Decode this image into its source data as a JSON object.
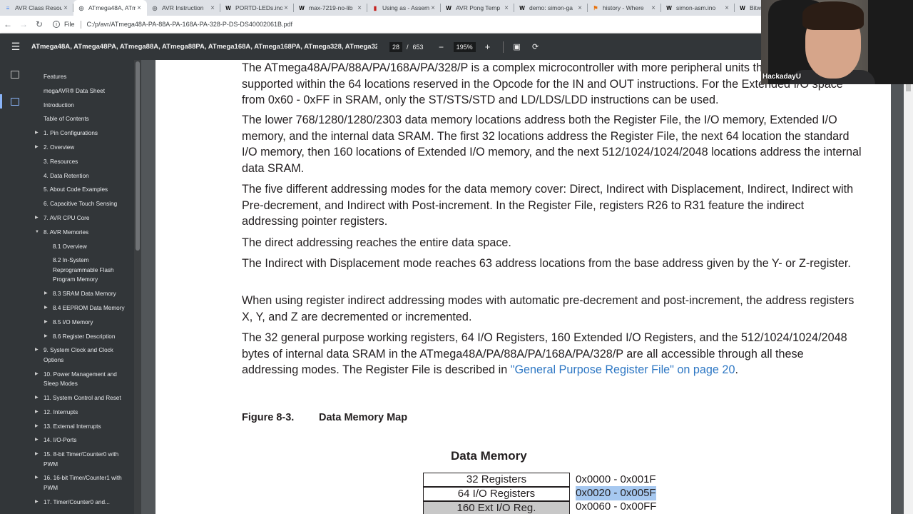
{
  "tabs": [
    {
      "label": "AVR Class Resou",
      "icon": "docs-icon",
      "color": "#4285f4",
      "active": false
    },
    {
      "label": "ATmega48A, ATm",
      "icon": "chrome-icon",
      "color": "#5f6368",
      "active": true
    },
    {
      "label": "AVR Instruction",
      "icon": "chrome-icon",
      "color": "#5f6368",
      "active": false
    },
    {
      "label": "PORTD-LEDs.ino",
      "icon": "wikipedia-icon",
      "color": "#000000",
      "active": false
    },
    {
      "label": "max-7219-no-lib",
      "icon": "wikipedia-icon",
      "color": "#000000",
      "active": false
    },
    {
      "label": "Using as - Assem",
      "icon": "uspto-icon",
      "color": "#c5221f",
      "active": false
    },
    {
      "label": "AVR Pong Temp",
      "icon": "wikipedia-icon",
      "color": "#000000",
      "active": false
    },
    {
      "label": "demo: simon-ga",
      "icon": "wikipedia-icon",
      "color": "#000000",
      "active": false
    },
    {
      "label": "history - Where",
      "icon": "bookmark-icon",
      "color": "#e8710a",
      "active": false
    },
    {
      "label": "simon-asm.ino",
      "icon": "wikipedia-icon",
      "color": "#000000",
      "active": false
    },
    {
      "label": "Bitw",
      "icon": "wikipedia-icon",
      "color": "#000000",
      "active": false
    }
  ],
  "address": {
    "scheme_label": "File",
    "url": "C:/p/avr/ATmega48A-PA-88A-PA-168A-PA-328-P-DS-DS40002061B.pdf"
  },
  "pdf_toolbar": {
    "title": "ATmega48A, ATmega48PA, ATmega88A, ATmega88PA, ATmega168A, ATmega168PA, ATmega328, ATmega328...",
    "page_current": "28",
    "page_sep": "/",
    "page_total": "653",
    "zoom": "195%"
  },
  "outline": [
    {
      "label": "Features",
      "indent": 0,
      "arrow": "",
      "lines": 1
    },
    {
      "label": "megaAVR® Data Sheet",
      "indent": 0,
      "arrow": "",
      "lines": 1
    },
    {
      "label": "Introduction",
      "indent": 0,
      "arrow": "",
      "lines": 1
    },
    {
      "label": "Table of Contents",
      "indent": 0,
      "arrow": "",
      "lines": 1
    },
    {
      "label": "1. Pin Configurations",
      "indent": 0,
      "arrow": "▶",
      "lines": 1
    },
    {
      "label": "2. Overview",
      "indent": 0,
      "arrow": "▶",
      "lines": 1
    },
    {
      "label": "3. Resources",
      "indent": 0,
      "arrow": "",
      "lines": 1
    },
    {
      "label": "4. Data Retention",
      "indent": 0,
      "arrow": "",
      "lines": 1
    },
    {
      "label": "5. About Code Examples",
      "indent": 0,
      "arrow": "",
      "lines": 1
    },
    {
      "label": "6. Capacitive Touch Sensing",
      "indent": 0,
      "arrow": "",
      "lines": 1
    },
    {
      "label": "7. AVR CPU Core",
      "indent": 0,
      "arrow": "▶",
      "lines": 1
    },
    {
      "label": "8. AVR Memories",
      "indent": 0,
      "arrow": "▼",
      "lines": 1
    },
    {
      "label": "8.1 Overview",
      "indent": 1,
      "arrow": "",
      "lines": 1
    },
    {
      "label": "8.2 In-System Reprogrammable Flash Program Memory",
      "indent": 1,
      "arrow": "",
      "lines": 3
    },
    {
      "label": "8.3 SRAM Data Memory",
      "indent": 1,
      "arrow": "▶",
      "lines": 1
    },
    {
      "label": "8.4 EEPROM Data Memory",
      "indent": 1,
      "arrow": "▶",
      "lines": 2
    },
    {
      "label": "8.5 I/O Memory",
      "indent": 1,
      "arrow": "▶",
      "lines": 1
    },
    {
      "label": "8.6 Register Description",
      "indent": 1,
      "arrow": "▶",
      "lines": 1
    },
    {
      "label": "9. System Clock and Clock Options",
      "indent": 0,
      "arrow": "▶",
      "lines": 2
    },
    {
      "label": "10. Power Management and Sleep Modes",
      "indent": 0,
      "arrow": "▶",
      "lines": 2
    },
    {
      "label": "11. System Control and Reset",
      "indent": 0,
      "arrow": "▶",
      "lines": 1
    },
    {
      "label": "12. Interrupts",
      "indent": 0,
      "arrow": "▶",
      "lines": 1
    },
    {
      "label": "13. External Interrupts",
      "indent": 0,
      "arrow": "▶",
      "lines": 1
    },
    {
      "label": "14. I/O-Ports",
      "indent": 0,
      "arrow": "▶",
      "lines": 1
    },
    {
      "label": "15. 8-bit Timer/Counter0 with PWM",
      "indent": 0,
      "arrow": "▶",
      "lines": 2
    },
    {
      "label": "16. 16-bit Timer/Counter1 with PWM",
      "indent": 0,
      "arrow": "▶",
      "lines": 2
    },
    {
      "label": "17. Timer/Counter0 and...",
      "indent": 0,
      "arrow": "▶",
      "lines": 1
    }
  ],
  "document": {
    "paragraphs": [
      {
        "text": "The ATmega48A/PA/88A/PA/168A/PA/328/P is a complex microcontroller with more peripheral units than can be supported within the 64 locations reserved in the Opcode for the IN and OUT instructions. For the Extended I/O space from 0x60 - 0xFF in SRAM, only the ST/STS/STD and LD/LDS/LDD instructions can be used."
      },
      {
        "text": "The lower 768/1280/1280/2303 data memory locations address both the Register File, the I/O memory, Extended I/O memory, and the internal data SRAM. The first 32 locations address the Register File, the next 64 location the standard I/O memory, then 160 locations of Extended I/O memory, and the next 512/1024/1024/2048 locations address the internal data SRAM."
      },
      {
        "text": "The five different addressing modes for the data memory cover: Direct, Indirect with Displacement, Indirect, Indirect with Pre-decrement, and Indirect with Post-increment. In the Register File, registers R26 to R31 feature the indirect addressing pointer registers."
      },
      {
        "text": "The direct addressing reaches the entire data space."
      },
      {
        "text": "The Indirect with Displacement mode reaches 63 address locations from the base address given by the Y- or Z-register."
      },
      {
        "text": "When using register indirect addressing modes with automatic pre-decrement and post-increment, the address registers X, Y, and Z are decremented or incremented."
      }
    ],
    "last_paragraph": {
      "text": "The 32 general purpose working registers, 64 I/O Registers, 160 Extended I/O Registers, and the 512/1024/1024/2048 bytes of internal data SRAM in the ATmega48A/PA/88A/PA/168A/PA/328/P are all accessible through all these addressing modes. The Register File is described in ",
      "link": "\"General Purpose Register File\" on page 20",
      "tail": "."
    },
    "figure_number": "Figure 8-3.",
    "figure_title": "Data Memory Map",
    "diagram_title": "Data Memory",
    "memory_rows": [
      {
        "label": "32 Registers",
        "range": "0x0000 - 0x001F",
        "highlight": false,
        "fill": "#ffffff"
      },
      {
        "label": "64 I/O Registers",
        "range": "0x0020 - 0x005F",
        "highlight": true,
        "fill": "#ffffff"
      },
      {
        "label": "160 Ext I/O Reg.",
        "range": "0x0060 - 0x00FF",
        "highlight": false,
        "fill": "#c8c8c8"
      }
    ]
  },
  "webcam": {
    "watermark": "HackadayU"
  },
  "colors": {
    "link": "#2f78c4",
    "selection_highlight": "#a6c8f0",
    "toolbar_bg": "#323639",
    "viewer_bg": "#525659"
  }
}
